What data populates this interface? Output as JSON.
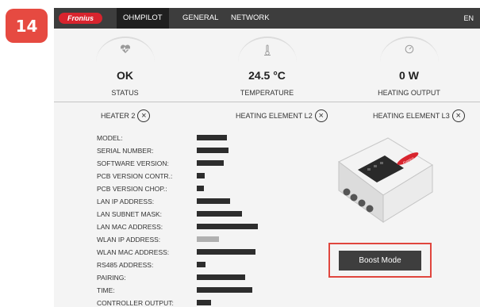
{
  "step_badge": "14",
  "nav": {
    "logo": "Fronius",
    "tabs": [
      {
        "label": "OHMPILOT"
      },
      {
        "label": "GENERAL"
      },
      {
        "label": "NETWORK"
      }
    ],
    "lang": "EN"
  },
  "status_columns": [
    {
      "icon": "heart-pulse-icon",
      "value": "OK",
      "label": "STATUS"
    },
    {
      "icon": "thermometer-icon",
      "value": "24.5 °C",
      "label": "TEMPERATURE"
    },
    {
      "icon": "gauge-icon",
      "value": "0 W",
      "label": "HEATING OUTPUT"
    }
  ],
  "heaters": [
    {
      "label": "HEATER 2"
    },
    {
      "label": "HEATING ELEMENT L2"
    },
    {
      "label": "HEATING ELEMENT L3"
    }
  ],
  "info_rows": [
    {
      "label": "MODEL:"
    },
    {
      "label": "SERIAL NUMBER:"
    },
    {
      "label": "SOFTWARE VERSION:"
    },
    {
      "label": "PCB VERSION CONTR.:"
    },
    {
      "label": "PCB VERSION CHOP.:"
    },
    {
      "label": "LAN IP ADDRESS:"
    },
    {
      "label": "LAN SUBNET MASK:"
    },
    {
      "label": "LAN MAC ADDRESS:"
    },
    {
      "label": "WLAN IP ADDRESS:"
    },
    {
      "label": "WLAN MAC ADDRESS:"
    },
    {
      "label": "RS485 ADDRESS:"
    },
    {
      "label": "PAIRING:"
    },
    {
      "label": "TIME:"
    },
    {
      "label": "CONTROLLER OUTPUT:"
    }
  ],
  "device_brand": "Fronius",
  "boost_button": "Boost Mode",
  "colors": {
    "accent": "#d8242e",
    "highlight": "#e0463e",
    "nav": "#3d3d3d"
  }
}
